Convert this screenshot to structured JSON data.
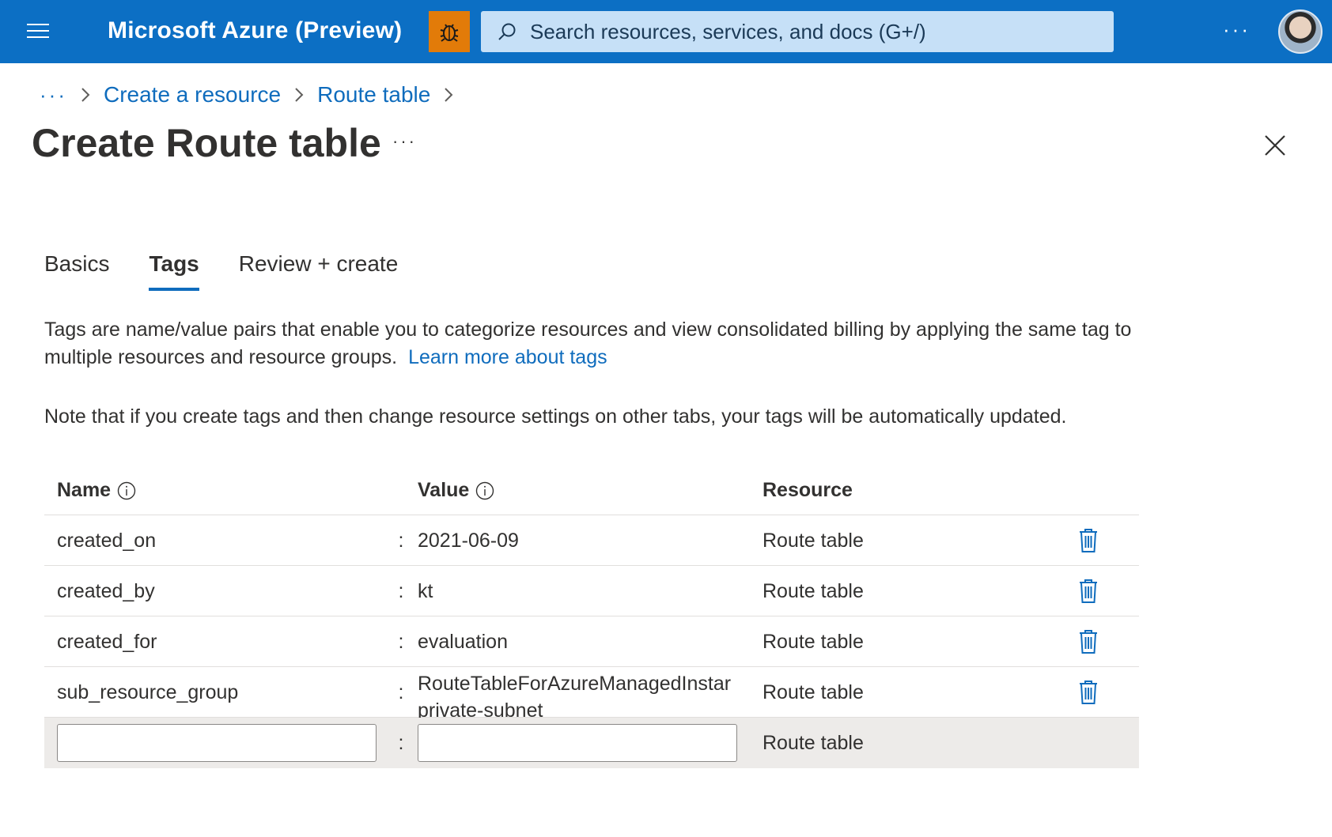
{
  "topbar": {
    "brand": "Microsoft Azure (Preview)",
    "search_placeholder": "Search resources, services, and docs (G+/)",
    "more": "···"
  },
  "breadcrumb": {
    "more": "···",
    "items": [
      "Create a resource",
      "Route table"
    ]
  },
  "page": {
    "title": "Create Route table",
    "more": "···"
  },
  "tabs": [
    {
      "label": "Basics",
      "active": false
    },
    {
      "label": "Tags",
      "active": true
    },
    {
      "label": "Review + create",
      "active": false
    }
  ],
  "description": {
    "text": "Tags are name/value pairs that enable you to categorize resources and view consolidated billing by applying the same tag to multiple resources and resource groups.",
    "link": "Learn more about tags"
  },
  "note": "Note that if you create tags and then change resource settings on other tabs, your tags will be automatically updated.",
  "table": {
    "headers": {
      "name": "Name",
      "value": "Value",
      "resource": "Resource"
    },
    "separator": ":",
    "rows": [
      {
        "name": "created_on",
        "value": "2021-06-09",
        "resource": "Route table"
      },
      {
        "name": "created_by",
        "value": "kt",
        "resource": "Route table"
      },
      {
        "name": "created_for",
        "value": "evaluation",
        "resource": "Route table"
      },
      {
        "name": "sub_resource_group",
        "value": "RouteTableForAzureManagedInstar private-subnet",
        "resource": "Route table"
      }
    ],
    "new_row": {
      "name": "",
      "value": "",
      "resource": "Route table"
    }
  },
  "colors": {
    "accent": "#0f6cbd",
    "topbar": "#0c6fc4",
    "bug_button": "#e27b09"
  }
}
